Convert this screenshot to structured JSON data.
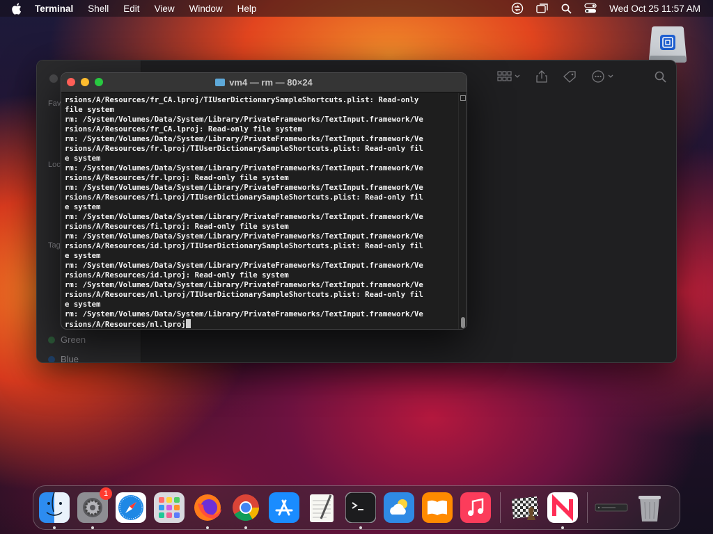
{
  "menubar": {
    "app_name": "Terminal",
    "items": [
      "Shell",
      "Edit",
      "View",
      "Window",
      "Help"
    ],
    "clock": "Wed Oct 25  11:57 AM"
  },
  "finder": {
    "sidebar_labels": [
      "Fav",
      "Loc",
      "Tag"
    ],
    "tags": [
      {
        "label": "Green",
        "color": "#34c759"
      },
      {
        "label": "Blue",
        "color": "#0a84ff"
      }
    ]
  },
  "terminal": {
    "title": "vm4 — rm — 80×24",
    "lines": [
      "rsions/A/Resources/fr_CA.lproj/TIUserDictionarySampleShortcuts.plist: Read-only",
      "file system",
      "rm: /System/Volumes/Data/System/Library/PrivateFrameworks/TextInput.framework/Ve",
      "rsions/A/Resources/fr_CA.lproj: Read-only file system",
      "rm: /System/Volumes/Data/System/Library/PrivateFrameworks/TextInput.framework/Ve",
      "rsions/A/Resources/fr.lproj/TIUserDictionarySampleShortcuts.plist: Read-only fil",
      "e system",
      "rm: /System/Volumes/Data/System/Library/PrivateFrameworks/TextInput.framework/Ve",
      "rsions/A/Resources/fr.lproj: Read-only file system",
      "rm: /System/Volumes/Data/System/Library/PrivateFrameworks/TextInput.framework/Ve",
      "rsions/A/Resources/fi.lproj/TIUserDictionarySampleShortcuts.plist: Read-only fil",
      "e system",
      "rm: /System/Volumes/Data/System/Library/PrivateFrameworks/TextInput.framework/Ve",
      "rsions/A/Resources/fi.lproj: Read-only file system",
      "rm: /System/Volumes/Data/System/Library/PrivateFrameworks/TextInput.framework/Ve",
      "rsions/A/Resources/id.lproj/TIUserDictionarySampleShortcuts.plist: Read-only fil",
      "e system",
      "rm: /System/Volumes/Data/System/Library/PrivateFrameworks/TextInput.framework/Ve",
      "rsions/A/Resources/id.lproj: Read-only file system",
      "rm: /System/Volumes/Data/System/Library/PrivateFrameworks/TextInput.framework/Ve",
      "rsions/A/Resources/nl.lproj/TIUserDictionarySampleShortcuts.plist: Read-only fil",
      "e system",
      "rm: /System/Volumes/Data/System/Library/PrivateFrameworks/TextInput.framework/Ve",
      "rsions/A/Resources/nl.lproj"
    ]
  },
  "dock": {
    "items": [
      {
        "icon": "finder-icon",
        "running": true
      },
      {
        "icon": "system-settings-icon",
        "running": true,
        "badge": "1"
      },
      {
        "icon": "safari-icon",
        "running": false
      },
      {
        "icon": "launchpad-icon",
        "running": false
      },
      {
        "icon": "firefox-icon",
        "running": true
      },
      {
        "icon": "chrome-icon",
        "running": true
      },
      {
        "icon": "app-store-icon",
        "running": false
      },
      {
        "icon": "textedit-icon",
        "running": false
      },
      {
        "icon": "terminal-icon",
        "running": true
      },
      {
        "icon": "weather-icon",
        "running": false
      },
      {
        "icon": "books-icon",
        "running": false
      },
      {
        "icon": "music-icon",
        "running": false
      },
      {
        "icon": "chess-icon",
        "running": false
      },
      {
        "icon": "news-icon",
        "running": true
      },
      {
        "icon": "minimized-window-icon",
        "running": false
      },
      {
        "icon": "trash-icon",
        "running": false
      }
    ]
  }
}
